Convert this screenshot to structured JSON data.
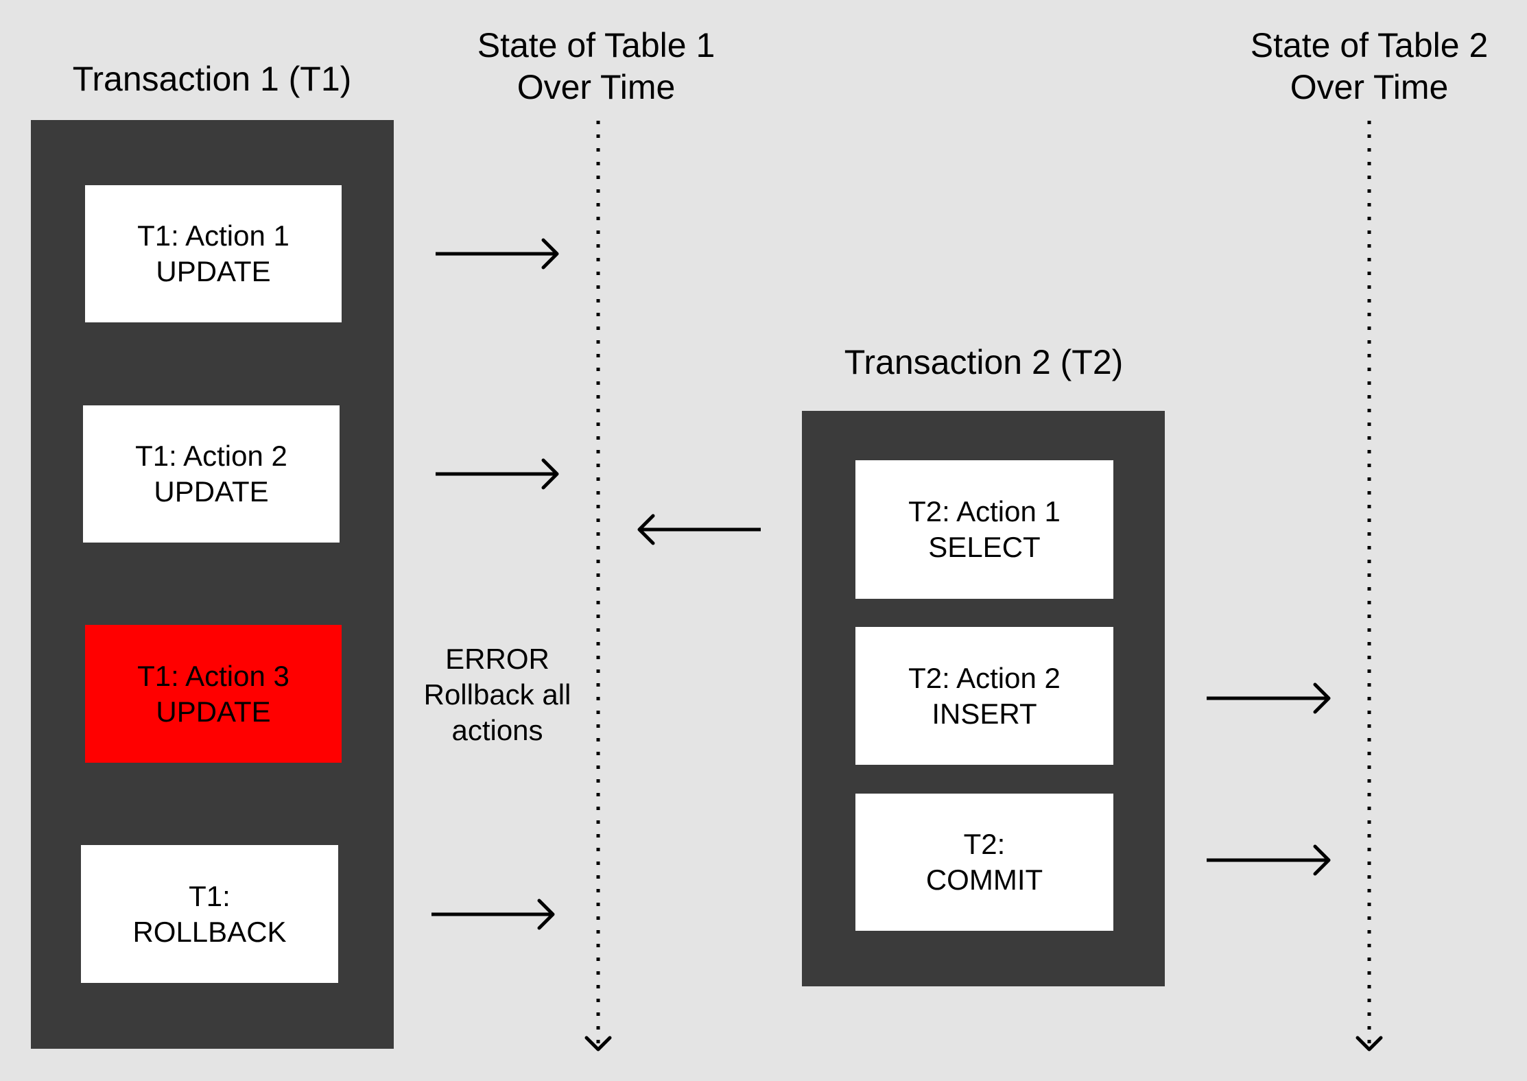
{
  "transaction1": {
    "title": "Transaction 1 (T1)",
    "actions": [
      {
        "line1": "T1: Action 1",
        "line2": "UPDATE",
        "status": "ok"
      },
      {
        "line1": "T1: Action 2",
        "line2": "UPDATE",
        "status": "ok"
      },
      {
        "line1": "T1: Action 3",
        "line2": "UPDATE",
        "status": "error"
      },
      {
        "line1": "T1:",
        "line2": "ROLLBACK",
        "status": "ok"
      }
    ]
  },
  "transaction2": {
    "title": "Transaction 2 (T2)",
    "actions": [
      {
        "line1": "T2: Action 1",
        "line2": "SELECT",
        "status": "ok"
      },
      {
        "line1": "T2: Action 2",
        "line2": "INSERT",
        "status": "ok"
      },
      {
        "line1": "T2:",
        "line2": "COMMIT",
        "status": "ok"
      }
    ]
  },
  "table1_timeline": {
    "title_line1": "State of Table 1",
    "title_line2": "Over Time"
  },
  "table2_timeline": {
    "title_line1": "State of Table 2",
    "title_line2": "Over Time"
  },
  "error_note": {
    "line1": "ERROR",
    "line2": "Rollback all",
    "line3": "actions"
  },
  "arrows": [
    {
      "from": "T1: Action 1",
      "to": "State of Table 1",
      "direction": "right"
    },
    {
      "from": "T1: Action 2",
      "to": "State of Table 1",
      "direction": "right"
    },
    {
      "from": "T1: ROLLBACK",
      "to": "State of Table 1",
      "direction": "right"
    },
    {
      "from": "State of Table 1",
      "to": "T2: Action 1",
      "direction": "left"
    },
    {
      "from": "T2: Action 2",
      "to": "State of Table 2",
      "direction": "right"
    },
    {
      "from": "T2: COMMIT",
      "to": "State of Table 2",
      "direction": "right"
    }
  ],
  "colors": {
    "background": "#e4e4e4",
    "transaction_box": "#3b3b3b",
    "action_box": "#ffffff",
    "error_box": "#ff0000",
    "ink": "#000000"
  }
}
